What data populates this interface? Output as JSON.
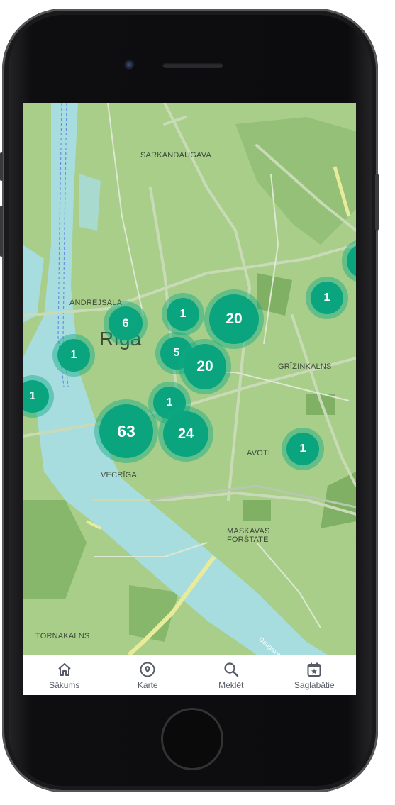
{
  "map": {
    "places": {
      "sarkandaugava": "SARKANDAUGAVA",
      "andrejsala": "ANDREJSALA",
      "riga": "Rīga",
      "grizinkalns": "GRĪZINKALNS",
      "vecriga": "VECRĪGA",
      "avoti": "AVOTI",
      "maskavas_forstate": "MASKAVAS FORŠTATE",
      "tornakalns": "TORŅAKALNS",
      "daugava": "Daugava"
    },
    "clusters": [
      "6",
      "1",
      "20",
      "1",
      "5",
      "20",
      "1",
      "1",
      "1",
      "63",
      "24",
      "1",
      ""
    ]
  },
  "tabbar": {
    "items": [
      {
        "label": "Sākums",
        "icon": "home-icon"
      },
      {
        "label": "Karte",
        "icon": "map-pin-icon"
      },
      {
        "label": "Meklēt",
        "icon": "search-icon"
      },
      {
        "label": "Saglabātie",
        "icon": "calendar-star-icon"
      }
    ]
  },
  "colors": {
    "map_land": "#a8ce8a",
    "water": "#a8dde0",
    "cluster": "#0aa57f",
    "tab_text": "#555b66"
  }
}
